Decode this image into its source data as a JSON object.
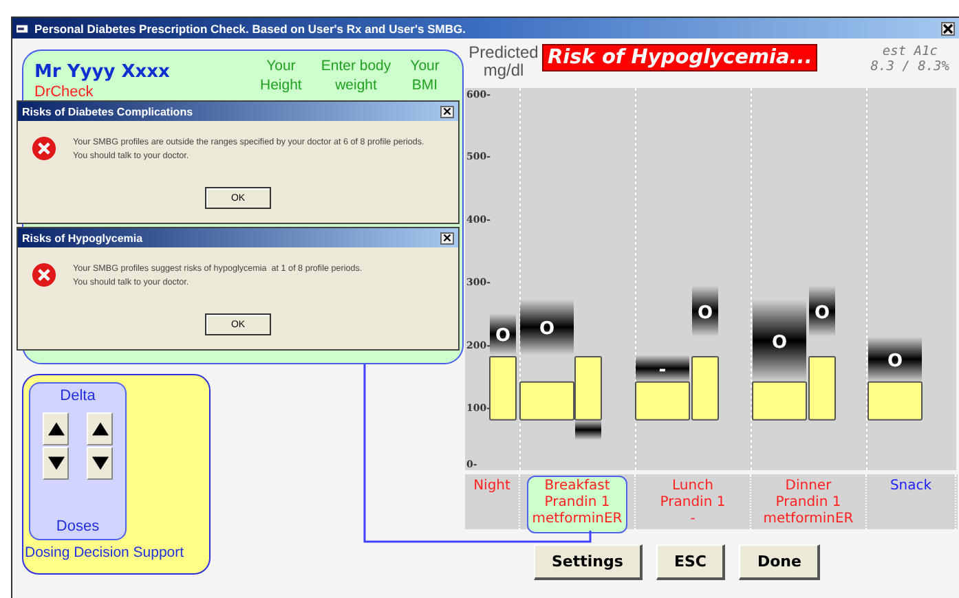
{
  "window": {
    "title": "Personal Diabetes Prescription Check.  Based on User's Rx and User's SMBG."
  },
  "patient": {
    "name": "Mr Yyyy Xxxx",
    "doctor": "DrCheck",
    "headers": [
      "Your\nHeight",
      "Enter body\nweight",
      "Your\nBMI"
    ]
  },
  "dialogs": [
    {
      "title": "Risks of Diabetes Complications",
      "message": "Your SMBG profiles are outside the ranges specified by your doctor at 6 of 8 profile periods.\nYou should talk to your doctor.",
      "button": "OK"
    },
    {
      "title": "Risks of Hypoglycemia",
      "message": "Your SMBG profiles suggest risks of hypoglycemia  at 1 of 8 profile periods.\nYou should talk to your doctor.",
      "button": "OK"
    }
  ],
  "dosing": {
    "title": "Delta",
    "footer": "Doses",
    "caption": "Dosing Decision Support"
  },
  "chart_header": {
    "unit": "Predicted\nmg/dl",
    "alert": "Risk of Hypoglycemia...",
    "a1c_label": "est A1c",
    "a1c_value": "8.3 / 8.3%"
  },
  "glucose_plot": {
    "tick_labels": [
      "600-",
      "500-",
      "400-",
      "300-",
      "200-",
      "100-",
      "0-"
    ],
    "marker_labels": [
      "O",
      "O",
      "-",
      "O",
      "O",
      "O",
      "O"
    ]
  },
  "periods": [
    {
      "label": "Night",
      "color": "#ff2020",
      "selected": false
    },
    {
      "label": "Breakfast\nPrandin 1\nmetforminER",
      "color": "#ff2020",
      "selected": true
    },
    {
      "label": "Lunch\nPrandin 1\n-",
      "color": "#ff2020",
      "selected": false
    },
    {
      "label": "Dinner\nPrandin 1\nmetforminER",
      "color": "#ff2020",
      "selected": false
    },
    {
      "label": "Snack",
      "color": "#2020ff",
      "selected": false
    }
  ],
  "buttons": [
    "Settings",
    "ESC",
    "Done"
  ]
}
